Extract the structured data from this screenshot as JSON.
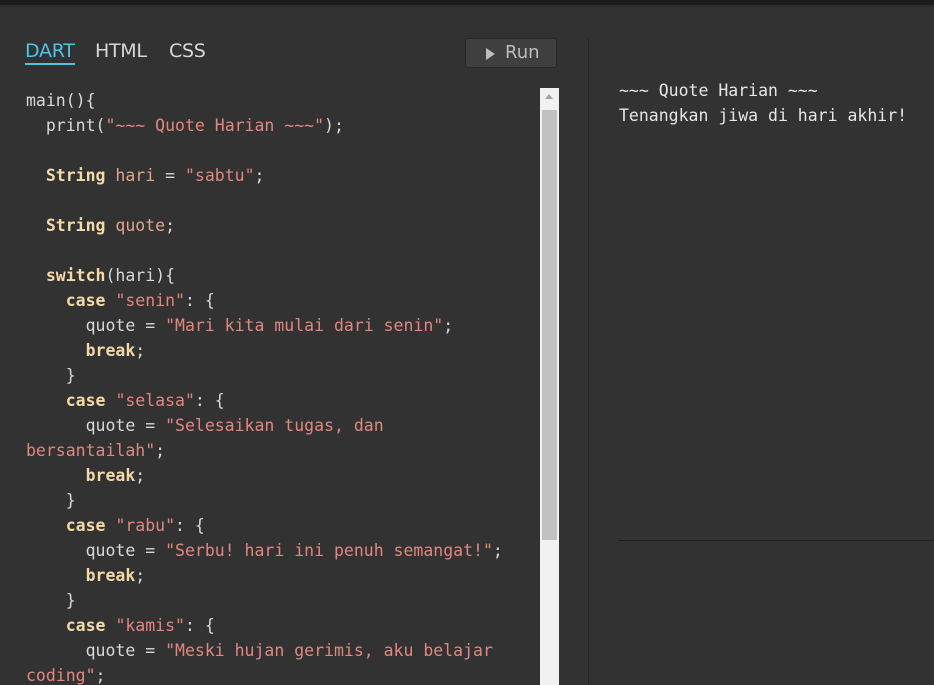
{
  "tabs": [
    {
      "label": "DART",
      "active": true
    },
    {
      "label": "HTML",
      "active": false
    },
    {
      "label": "CSS",
      "active": false
    }
  ],
  "run_button": {
    "label": "Run",
    "icon": "play-icon"
  },
  "editor": {
    "language": "dart",
    "lines": [
      [
        {
          "t": "main(){",
          "c": "plain"
        }
      ],
      [
        {
          "t": "  print(",
          "c": "plain"
        },
        {
          "t": "\"~~~ Quote Harian ~~~\"",
          "c": "str"
        },
        {
          "t": ");",
          "c": "plain"
        }
      ],
      [],
      [
        {
          "t": "  ",
          "c": "plain"
        },
        {
          "t": "String",
          "c": "kw"
        },
        {
          "t": " ",
          "c": "plain"
        },
        {
          "t": "hari",
          "c": "var"
        },
        {
          "t": " = ",
          "c": "plain"
        },
        {
          "t": "\"sabtu\"",
          "c": "str"
        },
        {
          "t": ";",
          "c": "plain"
        }
      ],
      [],
      [
        {
          "t": "  ",
          "c": "plain"
        },
        {
          "t": "String",
          "c": "kw"
        },
        {
          "t": " ",
          "c": "plain"
        },
        {
          "t": "quote",
          "c": "var"
        },
        {
          "t": ";",
          "c": "plain"
        }
      ],
      [],
      [
        {
          "t": "  ",
          "c": "plain"
        },
        {
          "t": "switch",
          "c": "kw"
        },
        {
          "t": "(hari){",
          "c": "plain"
        }
      ],
      [
        {
          "t": "    ",
          "c": "plain"
        },
        {
          "t": "case",
          "c": "kw"
        },
        {
          "t": " ",
          "c": "plain"
        },
        {
          "t": "\"senin\"",
          "c": "str"
        },
        {
          "t": ": {",
          "c": "plain"
        }
      ],
      [
        {
          "t": "      quote = ",
          "c": "plain"
        },
        {
          "t": "\"Mari kita mulai dari senin\"",
          "c": "str"
        },
        {
          "t": ";",
          "c": "plain"
        }
      ],
      [
        {
          "t": "      ",
          "c": "plain"
        },
        {
          "t": "break",
          "c": "kw"
        },
        {
          "t": ";",
          "c": "plain"
        }
      ],
      [
        {
          "t": "    }",
          "c": "plain"
        }
      ],
      [
        {
          "t": "    ",
          "c": "plain"
        },
        {
          "t": "case",
          "c": "kw"
        },
        {
          "t": " ",
          "c": "plain"
        },
        {
          "t": "\"selasa\"",
          "c": "str"
        },
        {
          "t": ": {",
          "c": "plain"
        }
      ],
      [
        {
          "t": "      quote = ",
          "c": "plain"
        },
        {
          "t": "\"Selesaikan tugas, dan",
          "c": "str"
        }
      ],
      [
        {
          "t": "bersantailah\"",
          "c": "str"
        },
        {
          "t": ";",
          "c": "plain"
        }
      ],
      [
        {
          "t": "      ",
          "c": "plain"
        },
        {
          "t": "break",
          "c": "kw"
        },
        {
          "t": ";",
          "c": "plain"
        }
      ],
      [
        {
          "t": "    }",
          "c": "plain"
        }
      ],
      [
        {
          "t": "    ",
          "c": "plain"
        },
        {
          "t": "case",
          "c": "kw"
        },
        {
          "t": " ",
          "c": "plain"
        },
        {
          "t": "\"rabu\"",
          "c": "str"
        },
        {
          "t": ": {",
          "c": "plain"
        }
      ],
      [
        {
          "t": "      quote = ",
          "c": "plain"
        },
        {
          "t": "\"Serbu! hari ini penuh semangat!\"",
          "c": "str"
        },
        {
          "t": ";",
          "c": "plain"
        }
      ],
      [
        {
          "t": "      ",
          "c": "plain"
        },
        {
          "t": "break",
          "c": "kw"
        },
        {
          "t": ";",
          "c": "plain"
        }
      ],
      [
        {
          "t": "    }",
          "c": "plain"
        }
      ],
      [
        {
          "t": "    ",
          "c": "plain"
        },
        {
          "t": "case",
          "c": "kw"
        },
        {
          "t": " ",
          "c": "plain"
        },
        {
          "t": "\"kamis\"",
          "c": "str"
        },
        {
          "t": ": {",
          "c": "plain"
        }
      ],
      [
        {
          "t": "      quote = ",
          "c": "plain"
        },
        {
          "t": "\"Meski hujan gerimis, aku belajar",
          "c": "str"
        }
      ],
      [
        {
          "t": "coding\"",
          "c": "str"
        },
        {
          "t": ";",
          "c": "plain"
        }
      ]
    ]
  },
  "output": {
    "lines": [
      "~~~ Quote Harian ~~~",
      "Tenangkan jiwa di hari akhir!"
    ]
  },
  "colors": {
    "background": "#323232",
    "accent_tab": "#4fc3e6",
    "keyword": "#f4d9a8",
    "string": "#e2877f",
    "variable": "#e2a48c"
  }
}
